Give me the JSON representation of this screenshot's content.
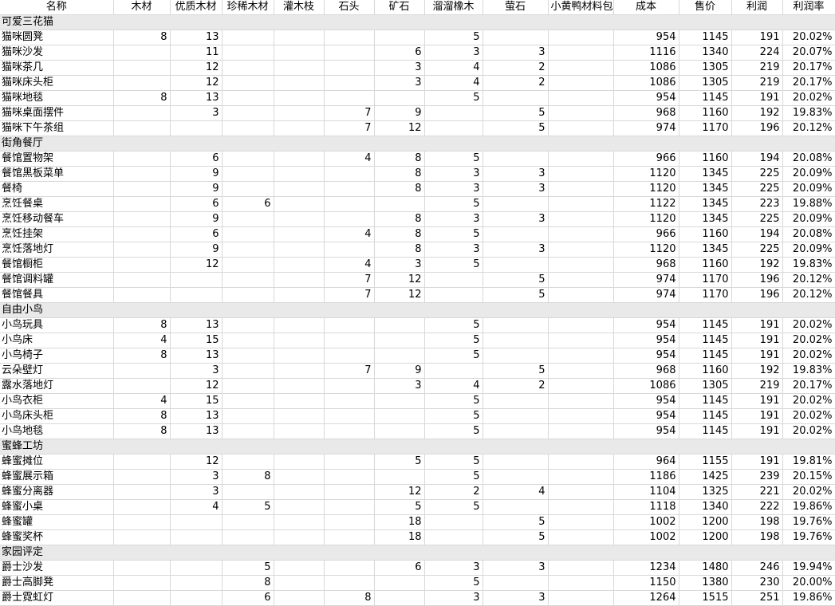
{
  "columns": [
    "名称",
    "木材",
    "优质木材",
    "珍稀木材",
    "灌木枝",
    "石头",
    "矿石",
    "溜溜橡木",
    "萤石",
    "小黄鸭材料包",
    "成本",
    "售价",
    "利润",
    "利润率"
  ],
  "groups": [
    {
      "name": "可爱三花猫",
      "rows": [
        [
          "猫咪圆凳",
          "8",
          "13",
          "",
          "",
          "",
          "",
          "5",
          "",
          "",
          "954",
          "1145",
          "191",
          "20.02%"
        ],
        [
          "猫咪沙发",
          "",
          "11",
          "",
          "",
          "",
          "6",
          "3",
          "3",
          "",
          "1116",
          "1340",
          "224",
          "20.07%"
        ],
        [
          "猫咪茶几",
          "",
          "12",
          "",
          "",
          "",
          "3",
          "4",
          "2",
          "",
          "1086",
          "1305",
          "219",
          "20.17%"
        ],
        [
          "猫咪床头柜",
          "",
          "12",
          "",
          "",
          "",
          "3",
          "4",
          "2",
          "",
          "1086",
          "1305",
          "219",
          "20.17%"
        ],
        [
          "猫咪地毯",
          "8",
          "13",
          "",
          "",
          "",
          "",
          "5",
          "",
          "",
          "954",
          "1145",
          "191",
          "20.02%"
        ],
        [
          "猫咪桌面摆件",
          "",
          "3",
          "",
          "",
          "7",
          "9",
          "",
          "5",
          "",
          "968",
          "1160",
          "192",
          "19.83%"
        ],
        [
          "猫咪下午茶组",
          "",
          "",
          "",
          "",
          "7",
          "12",
          "",
          "5",
          "",
          "974",
          "1170",
          "196",
          "20.12%"
        ]
      ]
    },
    {
      "name": "街角餐厅",
      "rows": [
        [
          "餐馆置物架",
          "",
          "6",
          "",
          "",
          "4",
          "8",
          "5",
          "",
          "",
          "966",
          "1160",
          "194",
          "20.08%"
        ],
        [
          "餐馆黑板菜单",
          "",
          "9",
          "",
          "",
          "",
          "8",
          "3",
          "3",
          "",
          "1120",
          "1345",
          "225",
          "20.09%"
        ],
        [
          "餐椅",
          "",
          "9",
          "",
          "",
          "",
          "8",
          "3",
          "3",
          "",
          "1120",
          "1345",
          "225",
          "20.09%"
        ],
        [
          "烹饪餐桌",
          "",
          "6",
          "6",
          "",
          "",
          "",
          "5",
          "",
          "",
          "1122",
          "1345",
          "223",
          "19.88%"
        ],
        [
          "烹饪移动餐车",
          "",
          "9",
          "",
          "",
          "",
          "8",
          "3",
          "3",
          "",
          "1120",
          "1345",
          "225",
          "20.09%"
        ],
        [
          "烹饪挂架",
          "",
          "6",
          "",
          "",
          "4",
          "8",
          "5",
          "",
          "",
          "966",
          "1160",
          "194",
          "20.08%"
        ],
        [
          "烹饪落地灯",
          "",
          "9",
          "",
          "",
          "",
          "8",
          "3",
          "3",
          "",
          "1120",
          "1345",
          "225",
          "20.09%"
        ],
        [
          "餐馆橱柜",
          "",
          "12",
          "",
          "",
          "4",
          "3",
          "5",
          "",
          "",
          "968",
          "1160",
          "192",
          "19.83%"
        ],
        [
          "餐馆调料罐",
          "",
          "",
          "",
          "",
          "7",
          "12",
          "",
          "5",
          "",
          "974",
          "1170",
          "196",
          "20.12%"
        ],
        [
          "餐馆餐具",
          "",
          "",
          "",
          "",
          "7",
          "12",
          "",
          "5",
          "",
          "974",
          "1170",
          "196",
          "20.12%"
        ]
      ]
    },
    {
      "name": "自由小鸟",
      "rows": [
        [
          "小鸟玩具",
          "8",
          "13",
          "",
          "",
          "",
          "",
          "5",
          "",
          "",
          "954",
          "1145",
          "191",
          "20.02%"
        ],
        [
          "小鸟床",
          "4",
          "15",
          "",
          "",
          "",
          "",
          "5",
          "",
          "",
          "954",
          "1145",
          "191",
          "20.02%"
        ],
        [
          "小鸟椅子",
          "8",
          "13",
          "",
          "",
          "",
          "",
          "5",
          "",
          "",
          "954",
          "1145",
          "191",
          "20.02%"
        ],
        [
          "云朵壁灯",
          "",
          "3",
          "",
          "",
          "7",
          "9",
          "",
          "5",
          "",
          "968",
          "1160",
          "192",
          "19.83%"
        ],
        [
          "露水落地灯",
          "",
          "12",
          "",
          "",
          "",
          "3",
          "4",
          "2",
          "",
          "1086",
          "1305",
          "219",
          "20.17%"
        ],
        [
          "小鸟衣柜",
          "4",
          "15",
          "",
          "",
          "",
          "",
          "5",
          "",
          "",
          "954",
          "1145",
          "191",
          "20.02%"
        ],
        [
          "小鸟床头柜",
          "8",
          "13",
          "",
          "",
          "",
          "",
          "5",
          "",
          "",
          "954",
          "1145",
          "191",
          "20.02%"
        ],
        [
          "小鸟地毯",
          "8",
          "13",
          "",
          "",
          "",
          "",
          "5",
          "",
          "",
          "954",
          "1145",
          "191",
          "20.02%"
        ]
      ]
    },
    {
      "name": "蜜蜂工坊",
      "rows": [
        [
          "蜂蜜摊位",
          "",
          "12",
          "",
          "",
          "",
          "5",
          "5",
          "",
          "",
          "964",
          "1155",
          "191",
          "19.81%"
        ],
        [
          "蜂蜜展示箱",
          "",
          "3",
          "8",
          "",
          "",
          "",
          "5",
          "",
          "",
          "1186",
          "1425",
          "239",
          "20.15%"
        ],
        [
          "蜂蜜分离器",
          "",
          "3",
          "",
          "",
          "",
          "12",
          "2",
          "4",
          "",
          "1104",
          "1325",
          "221",
          "20.02%"
        ],
        [
          "蜂蜜小桌",
          "",
          "4",
          "5",
          "",
          "",
          "5",
          "5",
          "",
          "",
          "1118",
          "1340",
          "222",
          "19.86%"
        ],
        [
          "蜂蜜罐",
          "",
          "",
          "",
          "",
          "",
          "18",
          "",
          "5",
          "",
          "1002",
          "1200",
          "198",
          "19.76%"
        ],
        [
          "蜂蜜奖杯",
          "",
          "",
          "",
          "",
          "",
          "18",
          "",
          "5",
          "",
          "1002",
          "1200",
          "198",
          "19.76%"
        ]
      ]
    },
    {
      "name": "家园评定",
      "rows": [
        [
          "爵士沙发",
          "",
          "",
          "5",
          "",
          "",
          "6",
          "3",
          "3",
          "",
          "1234",
          "1480",
          "246",
          "19.94%"
        ],
        [
          "爵士高脚凳",
          "",
          "",
          "8",
          "",
          "",
          "",
          "5",
          "",
          "",
          "1150",
          "1380",
          "230",
          "20.00%"
        ],
        [
          "爵士霓虹灯",
          "",
          "",
          "6",
          "",
          "8",
          "",
          "3",
          "3",
          "",
          "1264",
          "1515",
          "251",
          "19.86%"
        ]
      ]
    }
  ]
}
